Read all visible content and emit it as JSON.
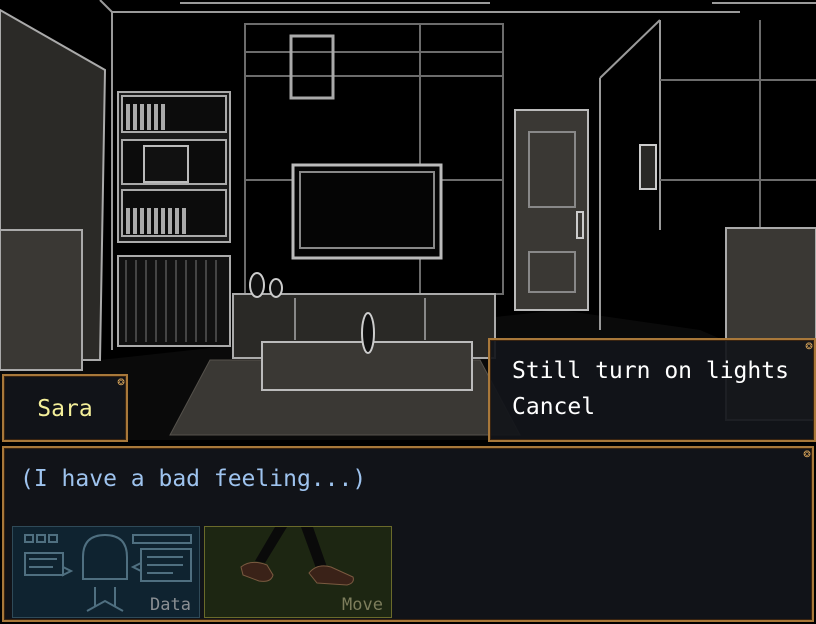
{
  "speaker": {
    "name": "Sara"
  },
  "choices": [
    {
      "label": "Still turn on lights"
    },
    {
      "label": "Cancel"
    }
  ],
  "message": {
    "text": "(I have a bad feeling...)"
  },
  "hud": {
    "data_label": "Data",
    "move_label": "Move"
  },
  "colors": {
    "window_border": "#a8783a",
    "name_text": "#f4ef9a",
    "message_text": "#9ec3ee",
    "choice_text": "#ffffff"
  }
}
